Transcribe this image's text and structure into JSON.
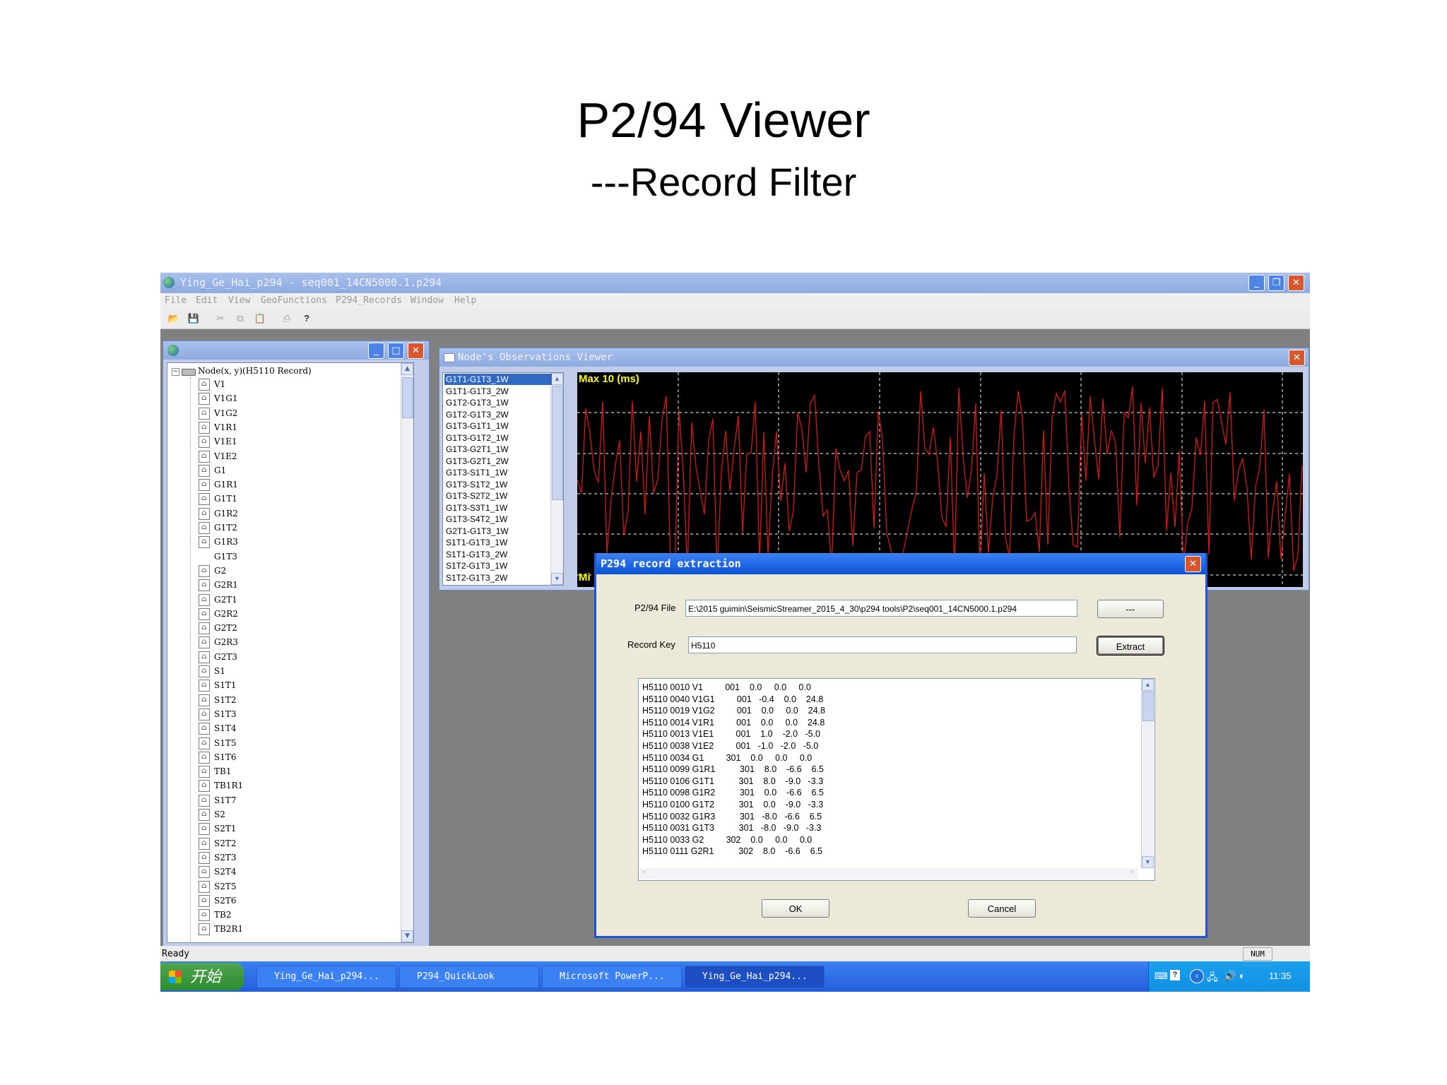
{
  "slide": {
    "title": "P2/94 Viewer",
    "subtitle": "---Record Filter"
  },
  "main_window": {
    "title": "Ying_Ge_Hai_p294 - seq001_14CN5000.1.p294"
  },
  "menu": [
    "File",
    "Edit",
    "View",
    "GeoFunctions",
    "P294_Records",
    "Window",
    "Help"
  ],
  "tree": {
    "root_label": "Node(x, y)(H5110 Record)",
    "items": [
      "V1",
      "V1G1",
      "V1G2",
      "V1R1",
      "V1E1",
      "V1E2",
      "G1",
      "G1R1",
      "G1T1",
      "G1R2",
      "G1T2",
      "G1R3",
      "G1T3",
      "G2",
      "G2R1",
      "G2T1",
      "G2R2",
      "G2T2",
      "G2R3",
      "G2T3",
      "S1",
      "S1T1",
      "S1T2",
      "S1T3",
      "S1T4",
      "S1T5",
      "S1T6",
      "TB1",
      "TB1R1",
      "S1T7",
      "S2",
      "S2T1",
      "S2T2",
      "S2T3",
      "S2T4",
      "S2T5",
      "S2T6",
      "TB2",
      "TB2R1"
    ]
  },
  "observations": {
    "title": "Node's Observations Viewer",
    "items": [
      "G1T1-G1T3_1W",
      "G1T1-G1T3_2W",
      "G1T2-G1T3_1W",
      "G1T2-G1T3_2W",
      "G1T3-G1T1_1W",
      "G1T3-G1T2_1W",
      "G1T3-G2T1_1W",
      "G1T3-G2T1_2W",
      "G1T3-S1T1_1W",
      "G1T3-S1T2_1W",
      "G1T3-S2T2_1W",
      "G1T3-S3T1_1W",
      "G1T3-S4T2_1W",
      "G2T1-G1T3_1W",
      "S1T1-G1T3_1W",
      "S1T1-G1T3_2W",
      "S1T2-G1T3_1W",
      "S1T2-G1T3_2W"
    ],
    "selected_index": 0,
    "max_label": "Max 10 (ms)",
    "min_label": "Mi"
  },
  "dialog": {
    "title": "P294 record extraction",
    "file_label": "P2/94 File",
    "file_value": "E:\\2015 guimin\\SeismicStreamer_2015_4_30\\p294 tools\\P2\\seq001_14CN5000.1.p294",
    "browse_label": "---",
    "key_label": "Record Key",
    "key_value": "H5110",
    "extract_label": "Extract",
    "ok_label": "OK",
    "cancel_label": "Cancel",
    "results": [
      "H5110 0010 V1         001    0.0     0.0     0.0",
      "H5110 0040 V1G1         001   -0.4    0.0    24.8",
      "H5110 0019 V1G2         001    0.0     0.0    24.8",
      "H5110 0014 V1R1         001    0.0     0.0    24.8",
      "H5110 0013 V1E1         001    1.0    -2.0   -5.0",
      "H5110 0038 V1E2         001   -1.0   -2.0   -5.0",
      "H5110 0034 G1         301    0.0     0.0     0.0",
      "H5110 0099 G1R1          301    8.0    -6.6    6.5",
      "H5110 0106 G1T1          301    8.0    -9.0   -3.3",
      "H5110 0098 G1R2          301    0.0    -6.6    6.5",
      "H5110 0100 G1T2          301    0.0    -9.0   -3.3",
      "H5110 0032 G1R3          301   -8.0   -6.6    6.5",
      "H5110 0031 G1T3          301   -8.0   -9.0   -3.3",
      "H5110 0033 G2         302    0.0     0.0     0.0",
      "H5110 0111 G2R1          302    8.0    -6.6    6.5"
    ]
  },
  "status": {
    "text": "Ready",
    "num": "NUM"
  },
  "taskbar": {
    "start": "开始",
    "tasks": [
      "Ying_Ge_Hai_p294...",
      "P294_QuickLook",
      "Microsoft PowerP...",
      "Ying_Ge_Hai_p294..."
    ],
    "clock": "11:35"
  },
  "colors": {
    "trace": "#d11a1a",
    "plot_bg": "#000000",
    "grid": "#ffffff",
    "max_label": "#ffff00"
  }
}
